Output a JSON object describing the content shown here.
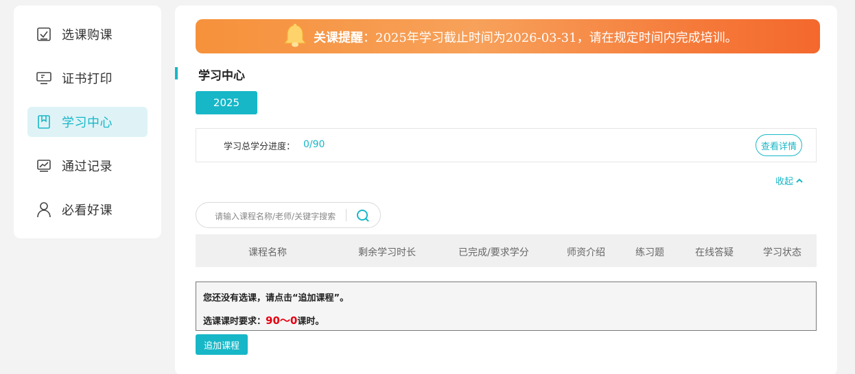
{
  "sidebar": {
    "items": [
      {
        "label": "选课购课",
        "icon": "checklist-icon",
        "active": false
      },
      {
        "label": "证书打印",
        "icon": "monitor-icon",
        "active": false
      },
      {
        "label": "学习中心",
        "icon": "bookmark-book-icon",
        "active": true
      },
      {
        "label": "通过记录",
        "icon": "chart-icon",
        "active": false
      },
      {
        "label": "必看好课",
        "icon": "user-icon",
        "active": false
      }
    ]
  },
  "banner": {
    "title": "关课提醒",
    "message": "：2025年学习截止时间为2026-03-31，请在规定时间内完成培训。",
    "icon": "bell-icon"
  },
  "section": {
    "title": "学习中心"
  },
  "year_button": "2025",
  "progress": {
    "label": "学习总学分进度：",
    "value": "0/90",
    "detail_button": "查看详情"
  },
  "collapse_label": "收起",
  "search": {
    "placeholder": "请输入课程名称/老师/关键字搜索",
    "icon": "search-icon"
  },
  "table": {
    "columns": [
      "课程名称",
      "剩余学习时长",
      "已完成/要求学分",
      "师资介绍",
      "练习题",
      "在线答疑",
      "学习状态"
    ]
  },
  "notice": {
    "line1": "您还没有选课，请点击“追加课程”。",
    "line2_prefix": "选课课时要求：",
    "line2_range": "90～0",
    "line2_suffix": "课时。"
  },
  "add_button": "追加课程",
  "colors": {
    "accent": "#17b7c7",
    "banner_start": "#f6913b",
    "banner_end": "#f4682d",
    "required_red": "#e60012"
  }
}
